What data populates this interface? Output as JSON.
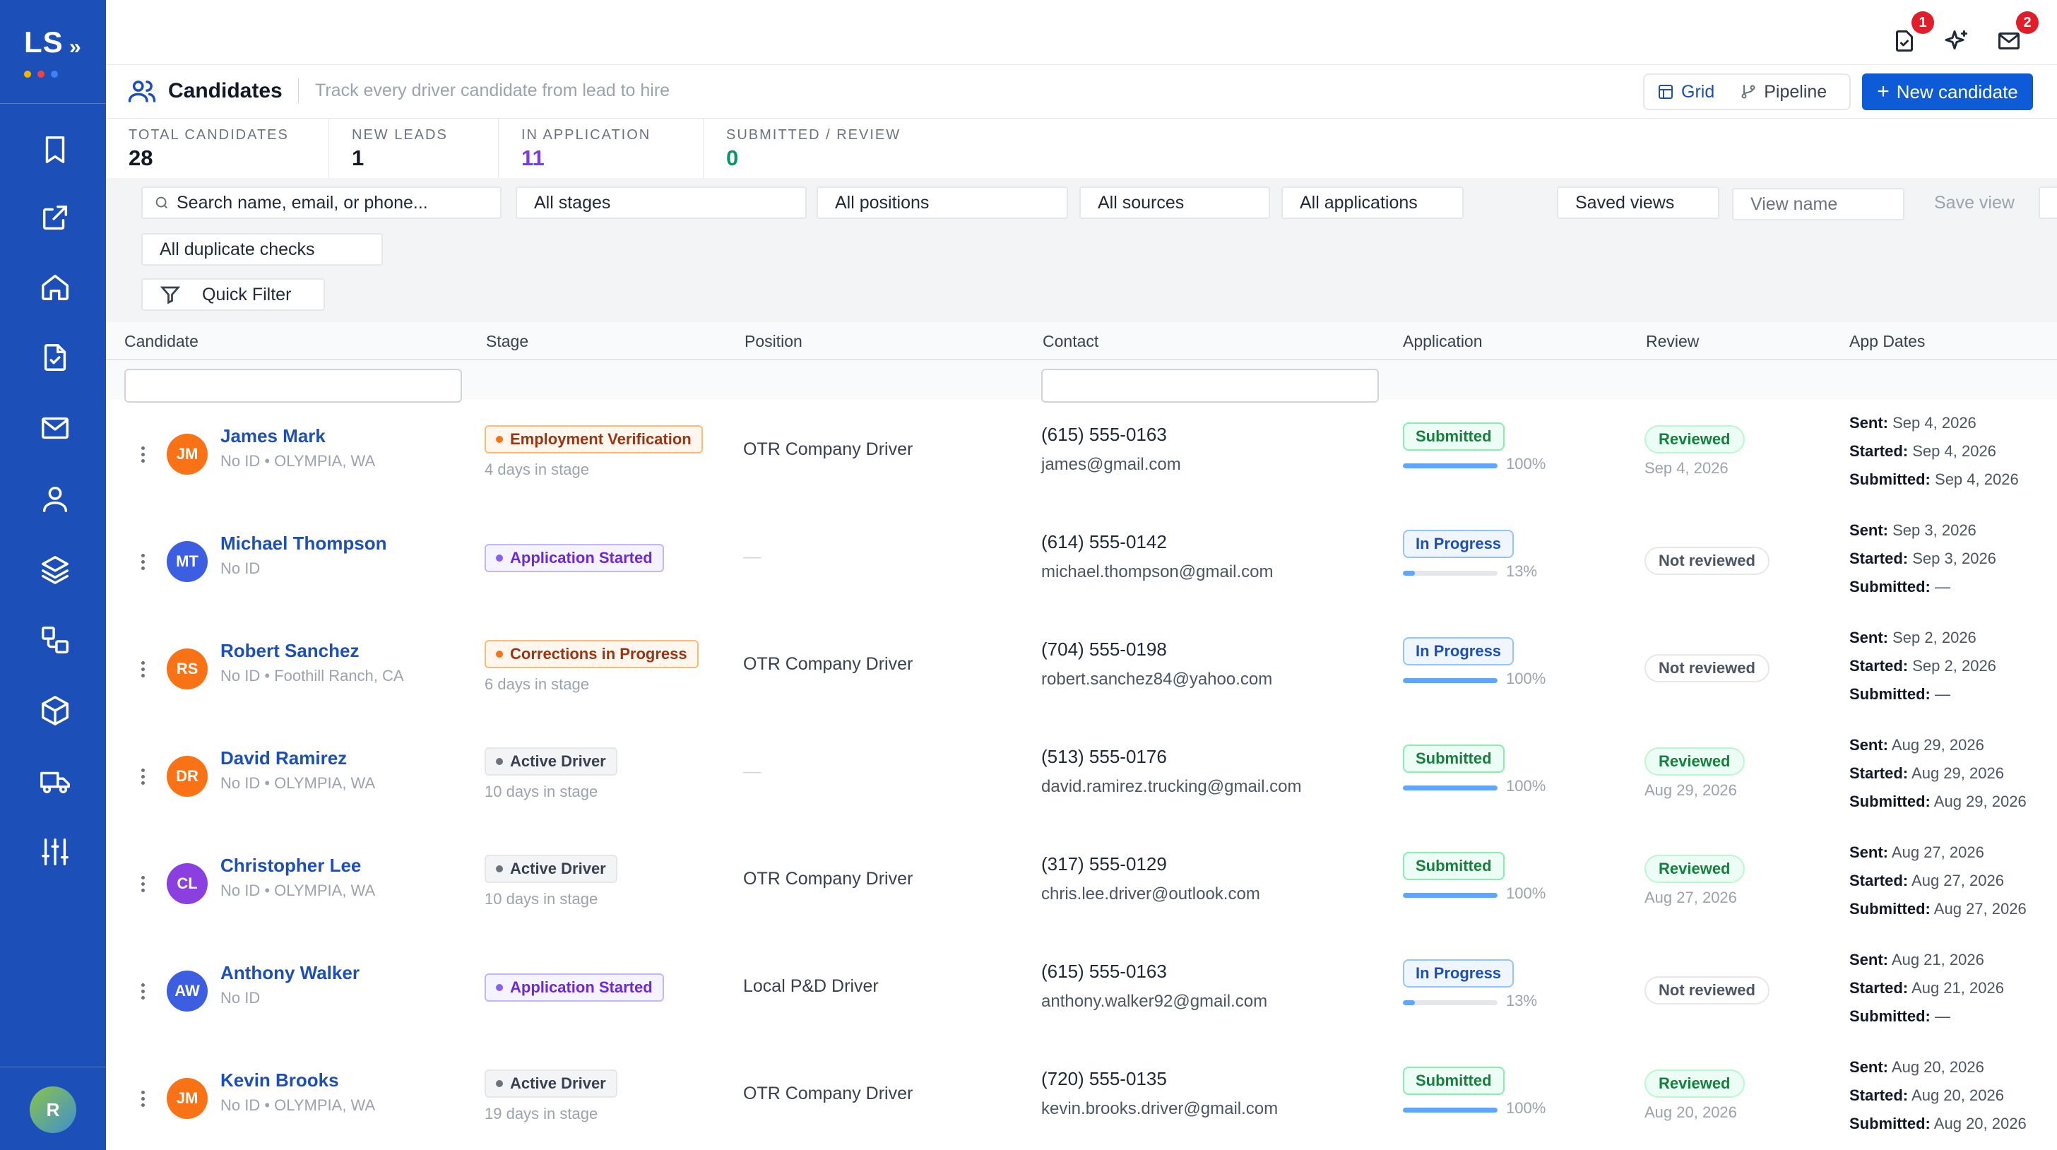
{
  "brand": {
    "logo": "LS",
    "chevron": "»",
    "dots": [
      "#f5b400",
      "#ef4444",
      "#3b82f6"
    ]
  },
  "sidebar": {
    "icons": [
      "bookmark-icon",
      "external-link-icon",
      "home-icon",
      "clipboard-check-icon",
      "mail-icon",
      "user-icon",
      "layers-icon",
      "workflow-icon",
      "package-icon",
      "truck-icon",
      "sliders-icon"
    ],
    "user_initial": "R"
  },
  "topbar": {
    "tasks_badge": "1",
    "messages_badge": "2"
  },
  "header": {
    "title": "Candidates",
    "subtitle": "Track every driver candidate from lead to hire",
    "grid_label": "Grid",
    "pipeline_label": "Pipeline",
    "new_button": "New candidate",
    "new_button_icon": "+"
  },
  "stats": [
    {
      "label": "Total candidates",
      "value": "28",
      "color": "#111827"
    },
    {
      "label": "New leads",
      "value": "1",
      "color": "#111827"
    },
    {
      "label": "In application",
      "value": "11",
      "color": "#7c3aed"
    },
    {
      "label": "Submitted / review",
      "value": "0",
      "color": "#059669"
    }
  ],
  "filters": {
    "search_placeholder": "Search name, email, or phone...",
    "stages": "All stages",
    "positions": "All positions",
    "sources": "All sources",
    "applications": "All applications",
    "saved_views": "Saved views",
    "view_name_placeholder": "View name",
    "save_view": "Save view",
    "duplicates": "All duplicate checks",
    "quick_filter": "Quick Filter"
  },
  "table": {
    "columns": [
      "Candidate",
      "Stage",
      "Position",
      "Contact",
      "Application",
      "Review",
      "App Dates"
    ],
    "date_labels": {
      "sent": "Sent:",
      "started": "Started:",
      "submitted": "Submitted:"
    },
    "rows": [
      {
        "initials": "JM",
        "avatar": "orange",
        "name": "James Mark",
        "sub": "No ID • OLYMPIA, WA",
        "stage": "Employment Verification",
        "stage_tone": "orange",
        "days": "4 days in stage",
        "position": "OTR Company Driver",
        "phone": "(615) 555-0163",
        "email": "james@gmail.com",
        "app_status": "Submitted",
        "app_tone": "submitted",
        "progress_pct": 100,
        "progress_label": "100%",
        "review": "Reviewed",
        "review_tone": "yes",
        "review_date": "Sep 4, 2026",
        "sent": "Sep 4, 2026",
        "started": "Sep 4, 2026",
        "submitted": "Sep 4, 2026"
      },
      {
        "initials": "MT",
        "avatar": "blue",
        "name": "Michael Thompson",
        "sub": "No ID",
        "stage": "Application Started",
        "stage_tone": "purple",
        "days": "",
        "position": "—",
        "phone": "(614) 555-0142",
        "email": "michael.thompson@gmail.com",
        "app_status": "In Progress",
        "app_tone": "progress",
        "progress_pct": 13,
        "progress_label": "13%",
        "review": "Not reviewed",
        "review_tone": "no",
        "review_date": "",
        "sent": "Sep 3, 2026",
        "started": "Sep 3, 2026",
        "submitted": "—"
      },
      {
        "initials": "RS",
        "avatar": "orange",
        "name": "Robert Sanchez",
        "sub": "No ID • Foothill Ranch, CA",
        "stage": "Corrections in Progress",
        "stage_tone": "orange",
        "days": "6 days in stage",
        "position": "OTR Company Driver",
        "phone": "(704) 555-0198",
        "email": "robert.sanchez84@yahoo.com",
        "app_status": "In Progress",
        "app_tone": "progress",
        "progress_pct": 100,
        "progress_label": "100%",
        "review": "Not reviewed",
        "review_tone": "no",
        "review_date": "",
        "sent": "Sep 2, 2026",
        "started": "Sep 2, 2026",
        "submitted": "—"
      },
      {
        "initials": "DR",
        "avatar": "orange",
        "name": "David Ramirez",
        "sub": "No ID • OLYMPIA, WA",
        "stage": "Active Driver",
        "stage_tone": "gray",
        "days": "10 days in stage",
        "position": "—",
        "phone": "(513) 555-0176",
        "email": "david.ramirez.trucking@gmail.com",
        "app_status": "Submitted",
        "app_tone": "submitted",
        "progress_pct": 100,
        "progress_label": "100%",
        "review": "Reviewed",
        "review_tone": "yes",
        "review_date": "Aug 29, 2026",
        "sent": "Aug 29, 2026",
        "started": "Aug 29, 2026",
        "submitted": "Aug 29, 2026"
      },
      {
        "initials": "CL",
        "avatar": "purple",
        "name": "Christopher Lee",
        "sub": "No ID • OLYMPIA, WA",
        "stage": "Active Driver",
        "stage_tone": "gray",
        "days": "10 days in stage",
        "position": "OTR Company Driver",
        "phone": "(317) 555-0129",
        "email": "chris.lee.driver@outlook.com",
        "app_status": "Submitted",
        "app_tone": "submitted",
        "progress_pct": 100,
        "progress_label": "100%",
        "review": "Reviewed",
        "review_tone": "yes",
        "review_date": "Aug 27, 2026",
        "sent": "Aug 27, 2026",
        "started": "Aug 27, 2026",
        "submitted": "Aug 27, 2026"
      },
      {
        "initials": "AW",
        "avatar": "blue",
        "name": "Anthony Walker",
        "sub": "No ID",
        "stage": "Application Started",
        "stage_tone": "purple",
        "days": "",
        "position": "Local P&D Driver",
        "phone": "(615) 555-0163",
        "email": "anthony.walker92@gmail.com",
        "app_status": "In Progress",
        "app_tone": "progress",
        "progress_pct": 13,
        "progress_label": "13%",
        "review": "Not reviewed",
        "review_tone": "no",
        "review_date": "",
        "sent": "Aug 21, 2026",
        "started": "Aug 21, 2026",
        "submitted": "—"
      },
      {
        "initials": "JM",
        "avatar": "orange",
        "name": "Kevin Brooks",
        "sub": "No ID • OLYMPIA, WA",
        "stage": "Active Driver",
        "stage_tone": "gray",
        "days": "19 days in stage",
        "position": "OTR Company Driver",
        "phone": "(720) 555-0135",
        "email": "kevin.brooks.driver@gmail.com",
        "app_status": "Submitted",
        "app_tone": "submitted",
        "progress_pct": 100,
        "progress_label": "100%",
        "review": "Reviewed",
        "review_tone": "yes",
        "review_date": "Aug 20, 2026",
        "sent": "Aug 20, 2026",
        "started": "Aug 20, 2026",
        "submitted": "Aug 20, 2026"
      }
    ]
  },
  "colors": {
    "sidebar": "#1d4fb8",
    "primary": "#0d5bd7",
    "avatar_orange": "#f97316",
    "avatar_blue": "#3b5fe0",
    "avatar_purple": "#8b3fe0"
  }
}
